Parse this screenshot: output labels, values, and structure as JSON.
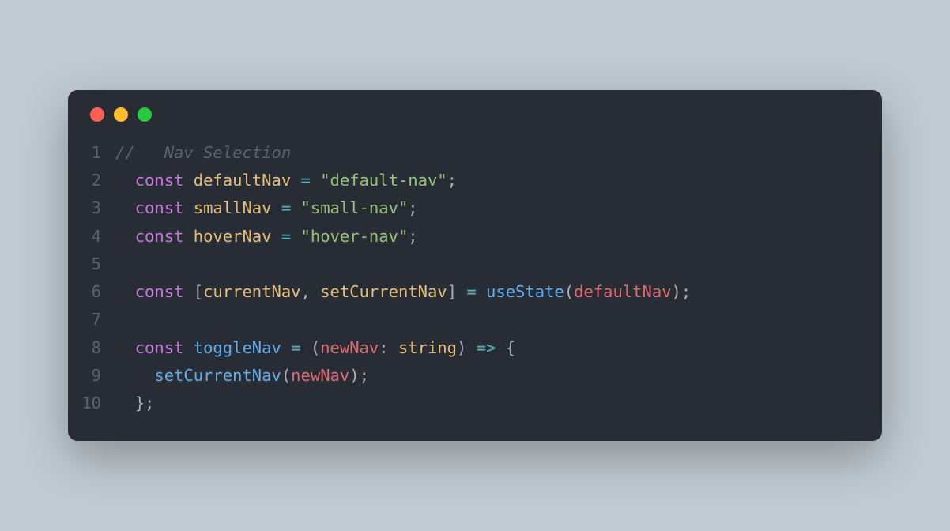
{
  "window": {
    "traffic_lights": [
      "red",
      "yellow",
      "green"
    ]
  },
  "code": {
    "lines": [
      {
        "num": "1",
        "tokens": [
          {
            "cls": "tk-comment",
            "text": "//   Nav Selection"
          }
        ]
      },
      {
        "num": "2",
        "tokens": [
          {
            "cls": "tk-default",
            "text": "  "
          },
          {
            "cls": "tk-keyword",
            "text": "const"
          },
          {
            "cls": "tk-default",
            "text": " "
          },
          {
            "cls": "tk-var",
            "text": "defaultNav"
          },
          {
            "cls": "tk-default",
            "text": " "
          },
          {
            "cls": "tk-op",
            "text": "="
          },
          {
            "cls": "tk-default",
            "text": " "
          },
          {
            "cls": "tk-string",
            "text": "\"default-nav\""
          },
          {
            "cls": "tk-punct",
            "text": ";"
          }
        ]
      },
      {
        "num": "3",
        "tokens": [
          {
            "cls": "tk-default",
            "text": "  "
          },
          {
            "cls": "tk-keyword",
            "text": "const"
          },
          {
            "cls": "tk-default",
            "text": " "
          },
          {
            "cls": "tk-var",
            "text": "smallNav"
          },
          {
            "cls": "tk-default",
            "text": " "
          },
          {
            "cls": "tk-op",
            "text": "="
          },
          {
            "cls": "tk-default",
            "text": " "
          },
          {
            "cls": "tk-string",
            "text": "\"small-nav\""
          },
          {
            "cls": "tk-punct",
            "text": ";"
          }
        ]
      },
      {
        "num": "4",
        "tokens": [
          {
            "cls": "tk-default",
            "text": "  "
          },
          {
            "cls": "tk-keyword",
            "text": "const"
          },
          {
            "cls": "tk-default",
            "text": " "
          },
          {
            "cls": "tk-var",
            "text": "hoverNav"
          },
          {
            "cls": "tk-default",
            "text": " "
          },
          {
            "cls": "tk-op",
            "text": "="
          },
          {
            "cls": "tk-default",
            "text": " "
          },
          {
            "cls": "tk-string",
            "text": "\"hover-nav\""
          },
          {
            "cls": "tk-punct",
            "text": ";"
          }
        ]
      },
      {
        "num": "5",
        "tokens": []
      },
      {
        "num": "6",
        "tokens": [
          {
            "cls": "tk-default",
            "text": "  "
          },
          {
            "cls": "tk-keyword",
            "text": "const"
          },
          {
            "cls": "tk-default",
            "text": " "
          },
          {
            "cls": "tk-punct",
            "text": "["
          },
          {
            "cls": "tk-var",
            "text": "currentNav"
          },
          {
            "cls": "tk-punct",
            "text": ", "
          },
          {
            "cls": "tk-var",
            "text": "setCurrentNav"
          },
          {
            "cls": "tk-punct",
            "text": "]"
          },
          {
            "cls": "tk-default",
            "text": " "
          },
          {
            "cls": "tk-op",
            "text": "="
          },
          {
            "cls": "tk-default",
            "text": " "
          },
          {
            "cls": "tk-func",
            "text": "useState"
          },
          {
            "cls": "tk-punct",
            "text": "("
          },
          {
            "cls": "tk-var2",
            "text": "defaultNav"
          },
          {
            "cls": "tk-punct",
            "text": ");"
          }
        ]
      },
      {
        "num": "7",
        "tokens": []
      },
      {
        "num": "8",
        "tokens": [
          {
            "cls": "tk-default",
            "text": "  "
          },
          {
            "cls": "tk-keyword",
            "text": "const"
          },
          {
            "cls": "tk-default",
            "text": " "
          },
          {
            "cls": "tk-func",
            "text": "toggleNav"
          },
          {
            "cls": "tk-default",
            "text": " "
          },
          {
            "cls": "tk-op",
            "text": "="
          },
          {
            "cls": "tk-default",
            "text": " "
          },
          {
            "cls": "tk-punct",
            "text": "("
          },
          {
            "cls": "tk-param",
            "text": "newNav"
          },
          {
            "cls": "tk-punct",
            "text": ": "
          },
          {
            "cls": "tk-type",
            "text": "string"
          },
          {
            "cls": "tk-punct",
            "text": ")"
          },
          {
            "cls": "tk-default",
            "text": " "
          },
          {
            "cls": "tk-op",
            "text": "=>"
          },
          {
            "cls": "tk-default",
            "text": " "
          },
          {
            "cls": "tk-punct",
            "text": "{"
          }
        ]
      },
      {
        "num": "9",
        "tokens": [
          {
            "cls": "tk-default",
            "text": "    "
          },
          {
            "cls": "tk-func",
            "text": "setCurrentNav"
          },
          {
            "cls": "tk-punct",
            "text": "("
          },
          {
            "cls": "tk-var2",
            "text": "newNav"
          },
          {
            "cls": "tk-punct",
            "text": ");"
          }
        ]
      },
      {
        "num": "10",
        "tokens": [
          {
            "cls": "tk-default",
            "text": "  "
          },
          {
            "cls": "tk-punct",
            "text": "};"
          }
        ]
      }
    ]
  }
}
